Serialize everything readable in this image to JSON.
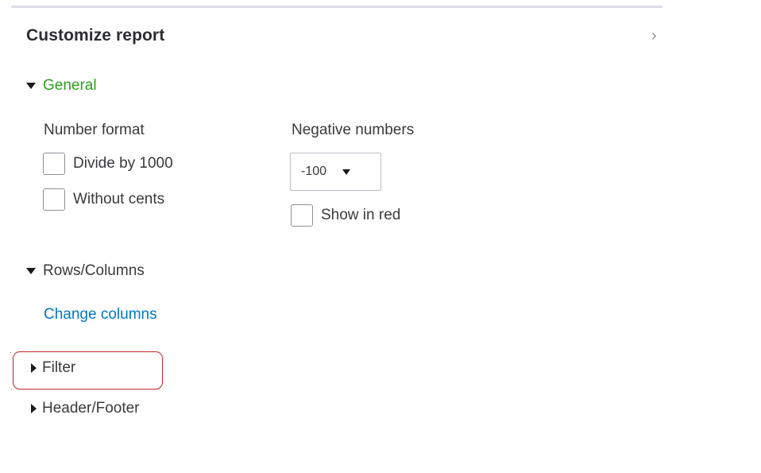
{
  "panel": {
    "title": "Customize report",
    "close_glyph": "›"
  },
  "sections": {
    "general": {
      "label": "General",
      "expanded": true,
      "color": "#2ca01c"
    },
    "rows_columns": {
      "label": "Rows/Columns",
      "expanded": true
    },
    "filter": {
      "label": "Filter",
      "expanded": false,
      "highlighted": true,
      "highlight_color": "#c0282b"
    },
    "header_footer": {
      "label": "Header/Footer",
      "expanded": false
    }
  },
  "number_format": {
    "label": "Number format",
    "options": [
      {
        "label": "Divide by 1000",
        "checked": false
      },
      {
        "label": "Without cents",
        "checked": false
      }
    ]
  },
  "negative_numbers": {
    "label": "Negative numbers",
    "selected": "-100",
    "show_in_red": {
      "label": "Show in red",
      "checked": false
    }
  },
  "links": {
    "change_columns": "Change columns",
    "link_color": "#0077c5"
  },
  "icons": {
    "close": "chevron-right-icon",
    "expanded": "triangle-down-icon",
    "collapsed": "triangle-right-icon",
    "dropdown": "caret-down-icon"
  }
}
